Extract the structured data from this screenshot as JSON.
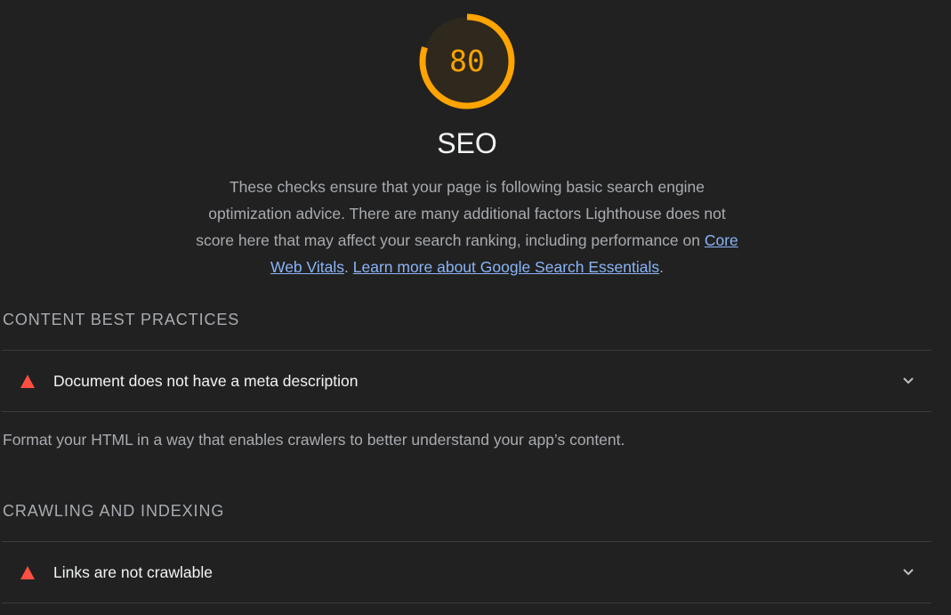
{
  "score": {
    "value": "80",
    "fraction": 0.8,
    "color": "#ffa400"
  },
  "category": {
    "title": "SEO",
    "description_text": "These checks ensure that your page is following basic search engine optimization advice. There are many additional factors Lighthouse does not score here that may affect your search ranking, including performance on ",
    "link1": "Core Web Vitals",
    "separator": ". ",
    "link2": "Learn more about Google Search Essentials",
    "end": "."
  },
  "groups": [
    {
      "title": "CONTENT BEST PRACTICES",
      "audits": [
        {
          "title": "Document does not have a meta description",
          "status": "fail",
          "icon": "fail-triangle-icon"
        }
      ],
      "description": "Format your HTML in a way that enables crawlers to better understand your app’s content."
    },
    {
      "title": "CRAWLING AND INDEXING",
      "audits": [
        {
          "title": "Links are not crawlable",
          "status": "fail",
          "icon": "fail-triangle-icon"
        }
      ]
    }
  ],
  "colors": {
    "background": "#212121",
    "fail": "#ff4e42",
    "link": "#8ab4f8"
  }
}
